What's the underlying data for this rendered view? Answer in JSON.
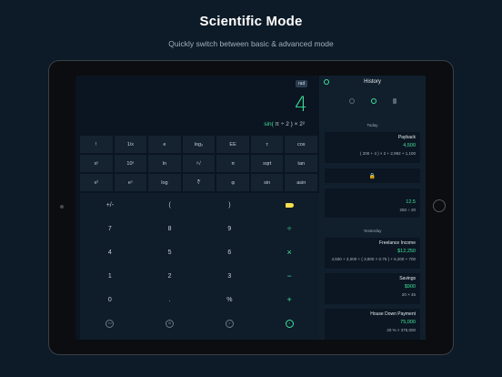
{
  "promo": {
    "title": "Scientific Mode",
    "subtitle": "Quickly switch between basic & advanced mode"
  },
  "display": {
    "mode_badge": "rad",
    "result": "4",
    "expression_fn": "sin(",
    "expression_rest": " π ÷ 2 ) × 2²"
  },
  "scientific_keys": [
    [
      "!",
      "1/x",
      "e",
      "log₂",
      "EE",
      "τ",
      "cos"
    ],
    [
      "xʸ",
      "10ˣ",
      "ln",
      "ʸ√",
      "π",
      "sqrt",
      "tan"
    ],
    [
      "x²",
      "eˣ",
      "log",
      "∛",
      "φ",
      "sin",
      "asin"
    ]
  ],
  "basic_keys": [
    [
      "+/-",
      "(",
      ")",
      ""
    ],
    [
      "7",
      "8",
      "9",
      "÷"
    ],
    [
      "4",
      "5",
      "6",
      "×"
    ],
    [
      "1",
      "2",
      "3",
      "−"
    ],
    [
      "0",
      ".",
      "%",
      "+"
    ]
  ],
  "bottom_icons": [
    {
      "icon": "more-icon",
      "label": "•••"
    },
    {
      "icon": "settings-icon",
      "label": "⚙"
    },
    {
      "icon": "clear-icon",
      "label": "c"
    },
    {
      "icon": "equals-icon",
      "label": "="
    }
  ],
  "history": {
    "title": "History",
    "section_today": "Today",
    "section_yesterday": "Yesterday",
    "lock_glyph": "🔒",
    "cards": [
      {
        "name": "Payback",
        "value": "4,500",
        "expr": "( 200 + 4 ) × 2 + 2,992 + 1,100"
      },
      {
        "name": "",
        "value": "12.5",
        "expr": "250 ÷ 20"
      },
      {
        "name": "Freelance Income",
        "value": "$12,250",
        "expr": "4,500 + 3,000 + ( 3,800 × 0.75 ) + 6,200 + 700"
      },
      {
        "name": "Savings",
        "value": "$900",
        "expr": "20 × 45"
      },
      {
        "name": "House Down Payment",
        "value": "75,000",
        "expr": "20 % × 375,000"
      }
    ]
  },
  "colors": {
    "accent": "#3fe29a",
    "delete_key": "#f4e04d",
    "background": "#0d1a27"
  }
}
